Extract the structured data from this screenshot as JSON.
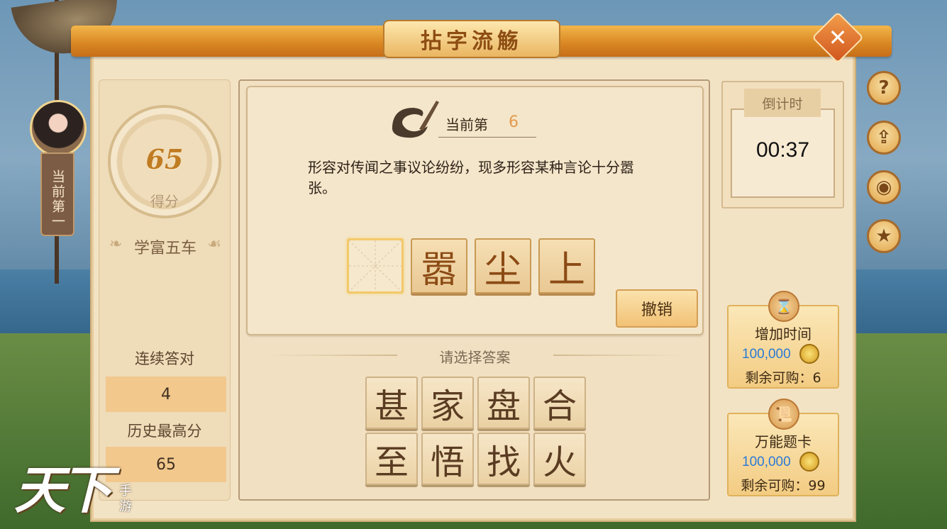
{
  "title": "拈字流觞",
  "player": {
    "rank_tag": "当前第一"
  },
  "score": {
    "value": "65",
    "label": "得分",
    "rank_title": "学富五车"
  },
  "stats": {
    "streak_label": "连续答对",
    "streak_value": "4",
    "best_label": "历史最高分",
    "best_value": "65"
  },
  "question": {
    "current_label": "当前第",
    "current_number": "6",
    "text": "形容对传闻之事议论纷纷，现多形容某种言论十分嚣张。",
    "slots": [
      "",
      "嚣",
      "尘",
      "上"
    ],
    "undo_label": "撤销"
  },
  "answers": {
    "prompt": "请选择答案",
    "options": [
      "甚",
      "家",
      "盘",
      "合",
      "至",
      "悟",
      "找",
      "火"
    ]
  },
  "timer": {
    "label": "倒计时",
    "value": "00:37"
  },
  "shop": {
    "add_time": {
      "title": "增加时间",
      "cost": "100,000",
      "remain": "剩余可购：6"
    },
    "wild_card": {
      "title": "万能题卡",
      "cost": "100,000",
      "remain": "剩余可购：99"
    }
  },
  "side_buttons": [
    "help-icon",
    "share-icon",
    "eye-icon",
    "medal-icon"
  ],
  "logo": {
    "main": "天下",
    "sub": "手游"
  }
}
